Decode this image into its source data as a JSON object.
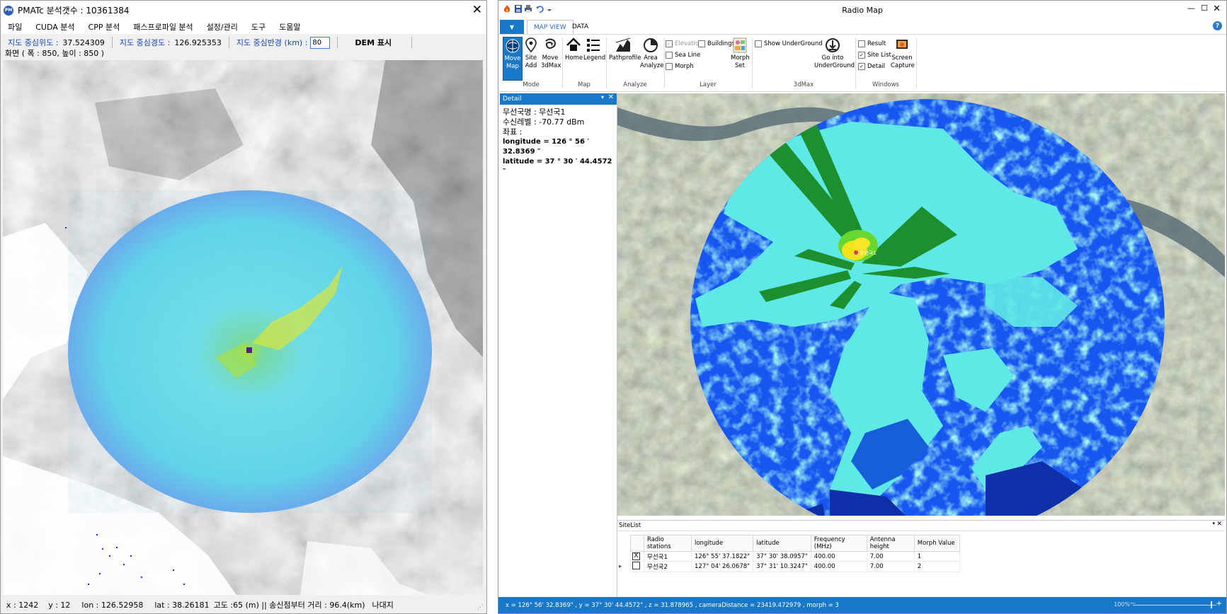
{
  "left_window": {
    "title": "PMATc  분석갯수 : 10361384",
    "app_icon_text": "PM",
    "close_glyph": "✕",
    "menu": [
      "파일",
      "CUDA 분석",
      "CPP 분석",
      "패스프로파일 분석",
      "설정/관리",
      "도구",
      "도움말"
    ],
    "toolbar": {
      "lat_label": "지도 중심위도 :",
      "lat_value": "37.524309",
      "lon_label": "지도 중심경도 :",
      "lon_value": "126.925353",
      "radius_label": "지도 중심반경 (km) :",
      "radius_value": "80",
      "dem_button": "DEM 표시"
    },
    "screen_info": "화면  ( 폭 : 850,  높이 : 850 )",
    "status": {
      "x": "x : 1242",
      "y": "y : 12",
      "lon": "lon : 126.52958",
      "lat": "lat : 38.26181",
      "info": "고도 :65 (m) || 송신점부터 거리 : 96.4(km)",
      "area": "나대지"
    }
  },
  "right_window": {
    "title": "Radio Map",
    "window_controls": {
      "minimize": "—",
      "maximize": "☐",
      "close": "✕"
    },
    "ribbon_tabs": [
      "MAP VIEW",
      "DATA"
    ],
    "app_menu_glyph": "▼",
    "help_glyph": "?",
    "ribbon": {
      "mode": {
        "buttons": [
          "Move Map",
          "Site Add",
          "Move 3dMax"
        ],
        "group": "Mode"
      },
      "map": {
        "buttons": [
          "Home",
          "Legend"
        ],
        "group": "Map"
      },
      "analyze": {
        "buttons": [
          "Pathprofile",
          "Area Analyze"
        ],
        "group": "Analyze"
      },
      "layer": {
        "checks": [
          "Elevation",
          "Sea Line",
          "Morph",
          "Buildings"
        ],
        "button": "Morph Set",
        "group": "Layer"
      },
      "threedmax": {
        "check": "Show UnderGround",
        "button": "Go into UnderGround",
        "group": "3dMax"
      },
      "windows": {
        "checks": [
          "Result",
          "Site List",
          "Detail"
        ],
        "button": "Screen Capture",
        "group": "Windows"
      }
    },
    "detail": {
      "header": "Detail",
      "pin_glyph": "▾",
      "close_glyph": "✕",
      "station": "무선국명 : 무선국1",
      "level": "수신레벨 : -70.77 dBm",
      "coord_label": "좌표 :",
      "longitude": "longitude = 126 ° 56 ′ 32.8369 ″",
      "latitude": "latitude = 37 ° 30 ′ 44.4572 ″"
    },
    "map_marker_label": "무선국1",
    "sitelist": {
      "header": "SiteList",
      "columns": [
        "Radio stations",
        "longitude",
        "latitude",
        "Frequency (MHz)",
        "Antenna height",
        "Morph Value"
      ],
      "rows": [
        {
          "marker": "",
          "checked": "X",
          "name": "무선국1",
          "lon": "126° 55' 37.1822\"",
          "lat": "37° 30' 38.0957\"",
          "freq": "400.00",
          "height": "7.00",
          "morph": "1"
        },
        {
          "marker": "▸",
          "checked": "",
          "name": "무선국2",
          "lon": "127° 04' 26.0678\"",
          "lat": "37° 31' 10.3247\"",
          "freq": "400.00",
          "height": "7.00",
          "morph": "2"
        }
      ]
    },
    "status_text": "x = 126° 56' 32.8369\" , y = 37° 30' 44.4572\" , z = 31.878965 , cameraDistance = 23419.472979 , morph = 3",
    "zoom": "100%",
    "zoom_minus": "—",
    "zoom_plus": "+"
  },
  "colors": {
    "ribbon_blue": "#1a78c8",
    "coverage_blue": "#1757f0",
    "coverage_light": "#5fe9e6",
    "coverage_green": "#1e8f2e",
    "coverage_yellow": "#f2e21a",
    "left_overlay": "#6fe0e9"
  }
}
